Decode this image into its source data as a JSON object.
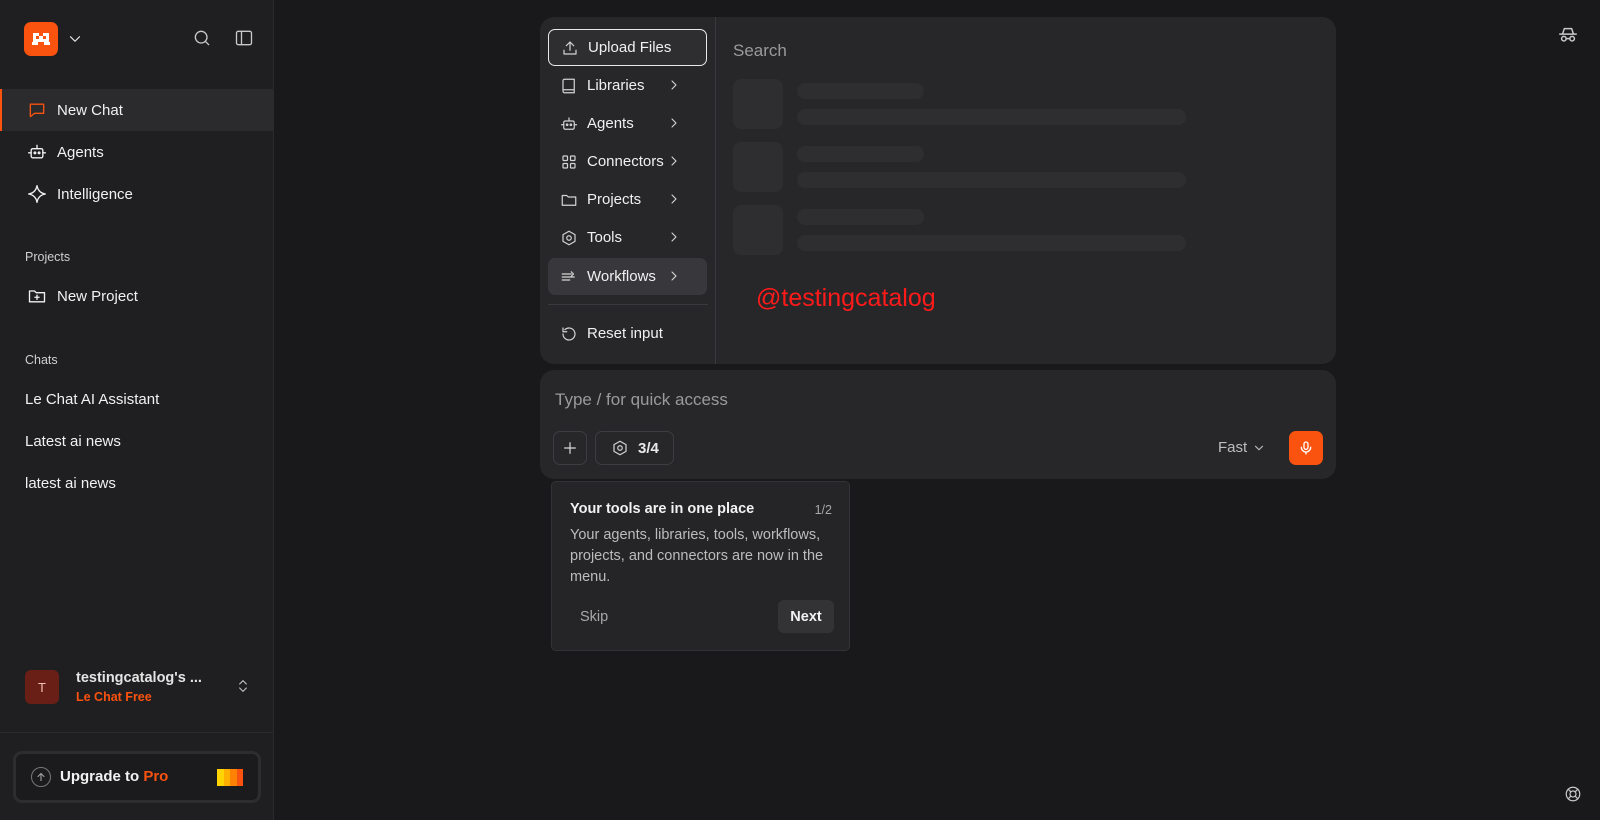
{
  "colors": {
    "accent": "#fa520f",
    "watermark": "#ff1a1a",
    "background": "#19191b",
    "sidebar": "#1f1f21"
  },
  "sidebar": {
    "nav": [
      {
        "label": "New Chat",
        "icon": "chat-bubble-icon"
      },
      {
        "label": "Agents",
        "icon": "robot-icon"
      },
      {
        "label": "Intelligence",
        "icon": "sparkle-icon"
      }
    ],
    "projects_label": "Projects",
    "new_project": "New Project",
    "chats_label": "Chats",
    "chats": [
      "Le Chat AI Assistant",
      "Latest ai news",
      "latest ai news"
    ],
    "account": {
      "initial": "T",
      "name": "testingcatalog's ...",
      "plan": "Le Chat Free"
    },
    "upgrade": {
      "text": "Upgrade to ",
      "pro": "Pro"
    }
  },
  "menu": {
    "items": [
      {
        "label": "Upload Files",
        "icon": "upload-icon"
      },
      {
        "label": "Libraries",
        "icon": "book-icon"
      },
      {
        "label": "Agents",
        "icon": "robot-icon"
      },
      {
        "label": "Connectors",
        "icon": "grid-icon"
      },
      {
        "label": "Projects",
        "icon": "folder-icon"
      },
      {
        "label": "Tools",
        "icon": "hexagon-icon"
      },
      {
        "label": "Workflows",
        "icon": "workflow-icon"
      }
    ],
    "reset": "Reset input",
    "search_placeholder": "Search"
  },
  "watermark": "@testingcatalog",
  "composer": {
    "placeholder": "Type / for quick access",
    "tools_count": "3/4",
    "mode": "Fast"
  },
  "tour": {
    "title": "Your tools are in one place",
    "step": "1/2",
    "body": "Your agents, libraries, tools, workflows, projects, and connectors are now in the menu.",
    "skip": "Skip",
    "next": "Next"
  }
}
